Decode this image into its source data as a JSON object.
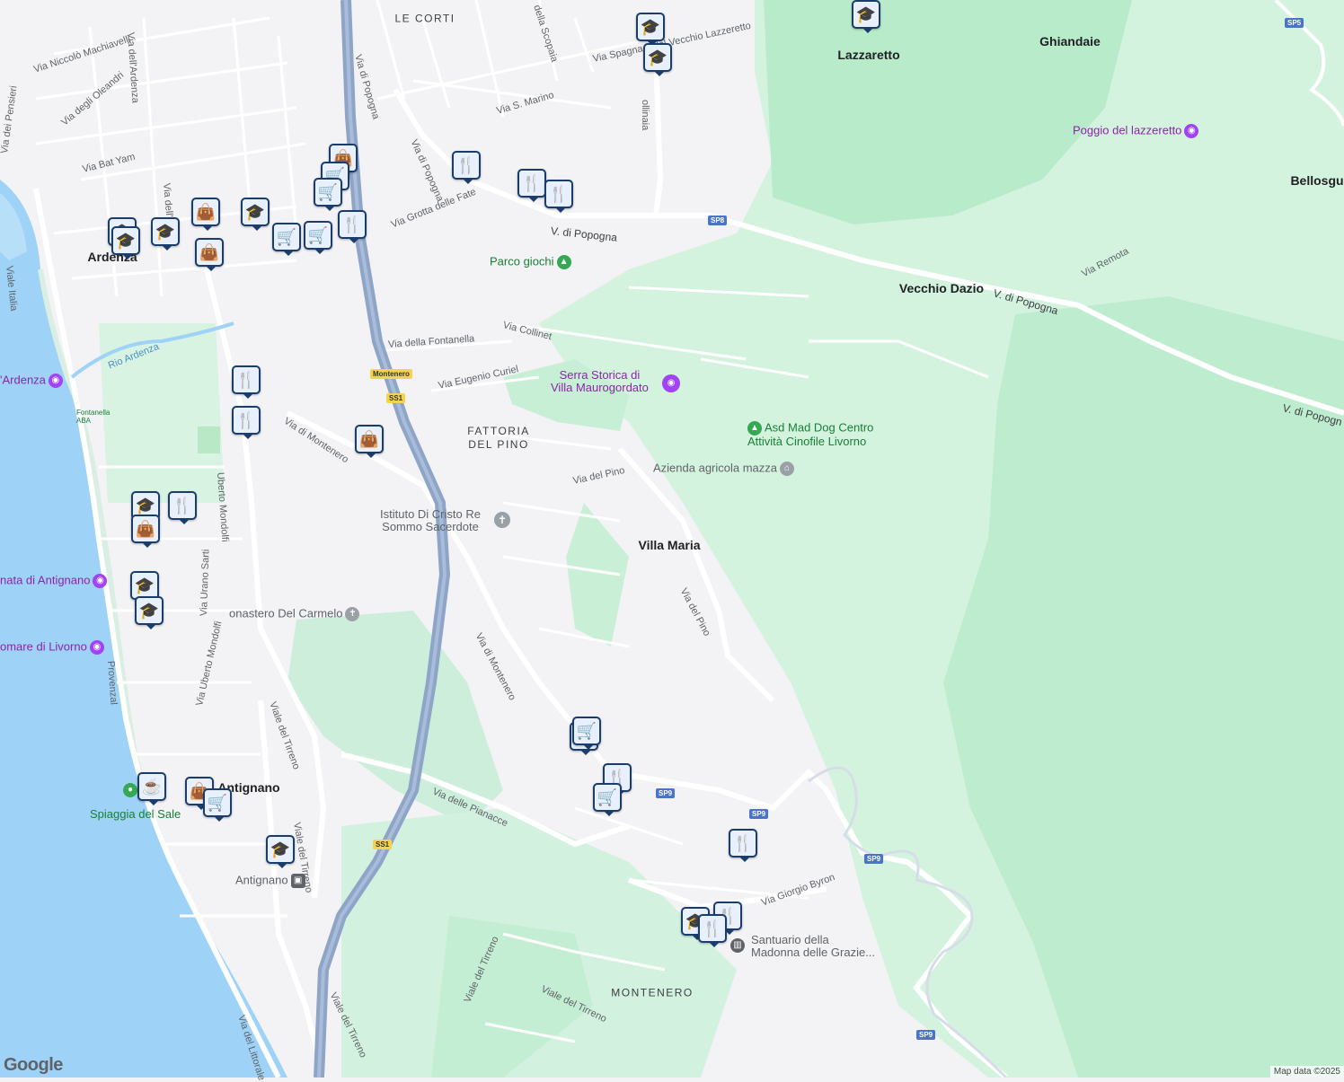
{
  "colors": {
    "water": "#9ed3f7",
    "park": "#cdf0dc",
    "forest": "#b9ebcc",
    "land": "#f3f3f5",
    "highway": "#8ea5c8",
    "road": "#ffffff",
    "marker_border": "#1a3d6b"
  },
  "places": {
    "lazzaretto": "Lazzaretto",
    "ghiandaie": "Ghiandaie",
    "bellosgu": "Bellosgu",
    "vecchio_dazio": "Vecchio Dazio",
    "villa_maria": "Villa Maria",
    "ardenza": "Ardenza",
    "antignano": "Antignano"
  },
  "districts": {
    "le_corti": "LE CORTI",
    "fattoria": "FATTORIA\nDEL PINO",
    "montenero": "MONTENERO"
  },
  "pois": {
    "poggio": "Poggio del lazzeretto",
    "parco": "Parco giochi",
    "serra": "Serra Storica di\nVilla Maurogordato",
    "asd": "Asd Mad Dog Centro\nAttività Cinofile Livorno",
    "azienda": "Azienda agricola mazza",
    "istituto": "Istituto Di Cristo Re\nSommo Sacerdote",
    "monastero": "onastero Del Carmelo",
    "ardenza_poi": "'Ardenza",
    "antignano_poi": "nata di Antignano",
    "livorno_poi": "omare di Livorno",
    "spiaggia": "Spiaggia del Sale",
    "santuario": "Santuario della\nMadonna delle Grazie...",
    "antignano_station": "Antignano",
    "fontanella": "Fontanella\nABA"
  },
  "streets": {
    "via_di_popogna_1": "Via di Popogna",
    "via_di_popogna_2": "Via di Popogna",
    "v_di_popogna_1": "V. di Popogna",
    "v_di_popogna_2": "V. di Popogna",
    "v_di_popogna_3": "V. di Popogn",
    "via_del_vecchio_lazzeretto": "Via Spagna a del Vecchio Lazzeretto",
    "via_s_marino": "Via S. Marino",
    "della_scopaia": "della Scopaia",
    "ollinaia": "ollinaia",
    "via_niccolo": "Via Niccolò Machiavelli",
    "via_oleandri": "Via degli Oleandri",
    "via_pensieri": "Via dei Pensieri",
    "via_bat_yam": "Via Bat Yam",
    "via_dellardenza": "Via dell'Ardenza",
    "via_dellard": "Via dell'Ard",
    "viale_italia": "Viale Italia",
    "via_grotta": "Via Grotta delle Fate",
    "via_remota": "Via Remota",
    "via_collinet": "Via Collinet",
    "via_fontanella": "Via della Fontanella",
    "via_curiel": "Via Eugenio Curiel",
    "rio_ardenza": "Rio Ardenza",
    "via_di_montenero_1": "Via di Montenero",
    "via_di_montenero_2": "Via di Montenero",
    "via_del_pino_1": "Via del Pino",
    "via_del_pino_2": "Via del Pino",
    "uberto_mondolfi": "Uberto Mondolfi",
    "via_urano_sarti": "Via Urano Sarti",
    "via_uberto_mondolfi": "Via Uberto Mondolfi",
    "viale_del_tirreno_1": "Viale del Tirreno",
    "viale_del_tirreno_2": "Viale del Tirreno",
    "viale_del_tirreno_3": "Viale del Tirreno",
    "viale_del_tirreno_4": "Viale del Tirreno",
    "viale_del_tirreno_5": "Viale del Tirreno",
    "via_pianacce": "Via delle Pianacce",
    "via_byron": "Via Giorgio Byron",
    "via_littorale": "Via del Littorale",
    "provenzal": "Provenzal",
    "montenero_sign": "Montenero"
  },
  "shields": {
    "sp5": "SP5",
    "sp8": "SP8",
    "sp9_a": "SP9",
    "sp9_b": "SP9",
    "sp9_c": "SP9",
    "sp9_d": "SP9",
    "ss1_a": "SS1",
    "ss1_b": "SS1"
  },
  "markers": [
    {
      "kind": "school-icon",
      "glyph": "🎓"
    },
    {
      "kind": "school-icon",
      "glyph": "🎓"
    },
    {
      "kind": "school-icon",
      "glyph": "🎓"
    },
    {
      "kind": "restaurant-icon",
      "glyph": "🍴"
    },
    {
      "kind": "restaurant-icon",
      "glyph": "🍴"
    },
    {
      "kind": "restaurant-icon",
      "glyph": "🍴"
    },
    {
      "kind": "shopping-bag-icon",
      "glyph": "👜"
    },
    {
      "kind": "cart-icon",
      "glyph": "🛒"
    },
    {
      "kind": "cart-icon",
      "glyph": "🛒"
    },
    {
      "kind": "restaurant-icon",
      "glyph": "🍴"
    },
    {
      "kind": "school-icon",
      "glyph": "🎓"
    },
    {
      "kind": "school-icon",
      "glyph": "🎓"
    },
    {
      "kind": "school-icon",
      "glyph": "🎓"
    },
    {
      "kind": "shopping-bag-icon",
      "glyph": "👜"
    },
    {
      "kind": "shopping-bag-icon",
      "glyph": "👜"
    },
    {
      "kind": "cart-icon",
      "glyph": "🛒"
    },
    {
      "kind": "cart-icon",
      "glyph": "🛒"
    },
    {
      "kind": "restaurant-icon",
      "glyph": "🍴"
    },
    {
      "kind": "restaurant-icon",
      "glyph": "🍴"
    },
    {
      "kind": "shopping-bag-icon",
      "glyph": "👜"
    },
    {
      "kind": "school-icon",
      "glyph": "🎓"
    },
    {
      "kind": "restaurant-icon",
      "glyph": "🍴"
    },
    {
      "kind": "shopping-bag-icon",
      "glyph": "👜"
    },
    {
      "kind": "school-icon",
      "glyph": "🎓"
    },
    {
      "kind": "school-icon",
      "glyph": "🎓"
    },
    {
      "kind": "cafe-icon",
      "glyph": "☕"
    },
    {
      "kind": "shopping-bag-icon",
      "glyph": "👜"
    },
    {
      "kind": "cart-icon",
      "glyph": "🛒"
    },
    {
      "kind": "school-icon",
      "glyph": "🎓"
    },
    {
      "kind": "cart-icon",
      "glyph": "🛒"
    },
    {
      "kind": "restaurant-icon",
      "glyph": "🍴"
    },
    {
      "kind": "cart-icon",
      "glyph": "🛒"
    },
    {
      "kind": "restaurant-icon",
      "glyph": "🍴"
    },
    {
      "kind": "school-icon",
      "glyph": "🎓"
    },
    {
      "kind": "restaurant-icon",
      "glyph": "🍴"
    },
    {
      "kind": "restaurant-icon",
      "glyph": "🍴"
    },
    {
      "kind": "school-icon",
      "glyph": "🎓"
    },
    {
      "kind": "cart-icon",
      "glyph": "🛒"
    }
  ],
  "footer": {
    "logo": "Google",
    "attribution": "Map data ©2025"
  }
}
